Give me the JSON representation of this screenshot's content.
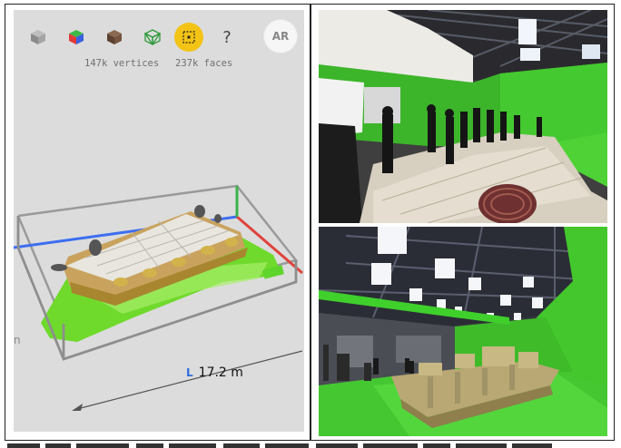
{
  "toolbar": {
    "tools": [
      {
        "name": "solid-model-icon"
      },
      {
        "name": "color-model-icon"
      },
      {
        "name": "textured-model-icon"
      },
      {
        "name": "wireframe-model-icon"
      },
      {
        "name": "bounding-box-icon",
        "active": true
      },
      {
        "name": "help-icon",
        "label": "?"
      }
    ],
    "ar_label": "AR"
  },
  "stats": {
    "vertices": "147k vertices",
    "faces": "237k faces"
  },
  "measurement": {
    "axis": "L",
    "value": "17.2 m"
  },
  "side_text": "n",
  "colors": {
    "accent": "#f3c316",
    "viewer_bg": "#dcdcdc",
    "axis_x": "#e0433c",
    "axis_y": "#3bb34a",
    "axis_z": "#3c6ef0",
    "chroma_green": "#3fc62a"
  }
}
